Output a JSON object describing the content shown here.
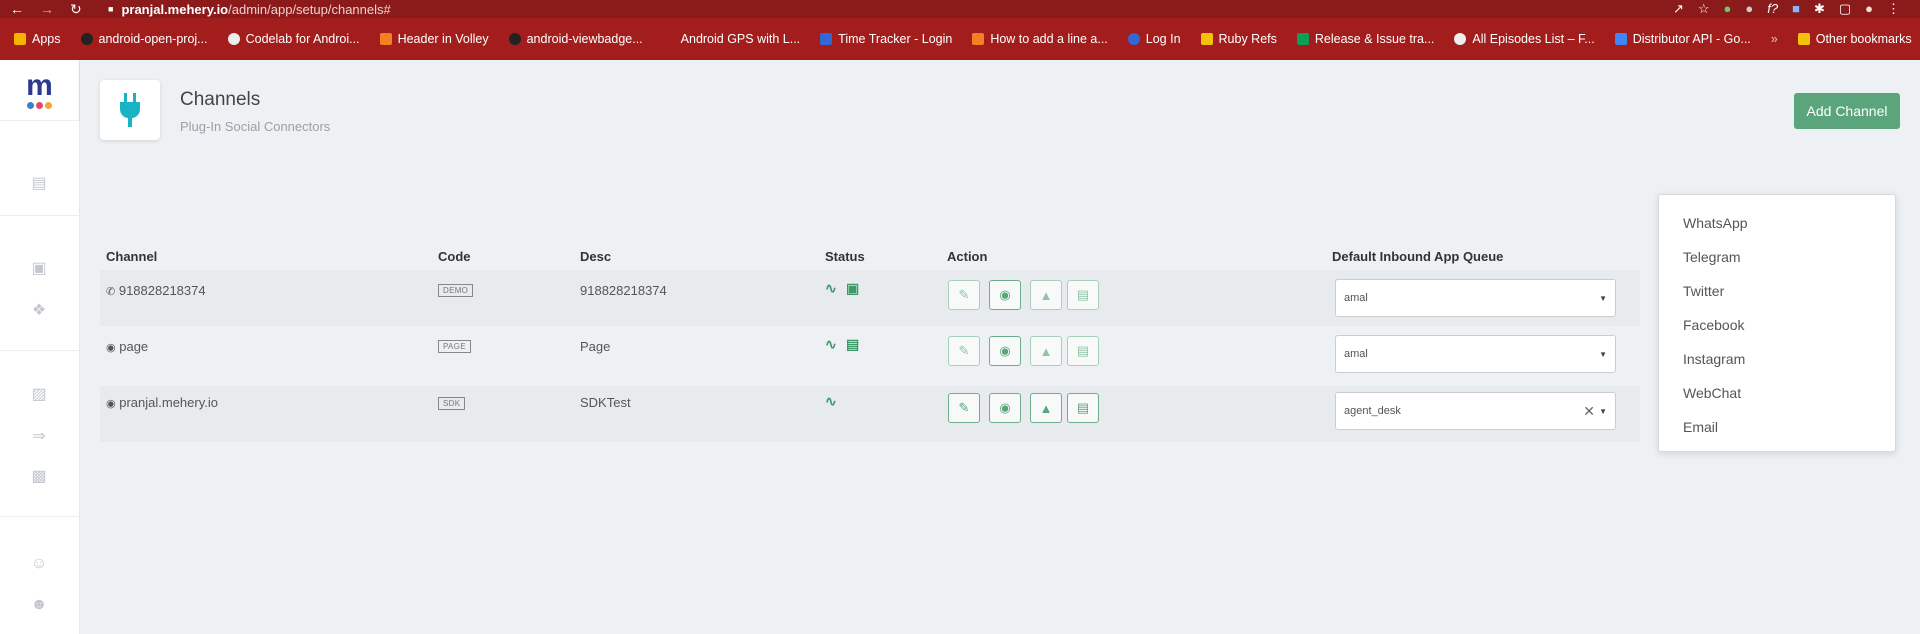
{
  "browser": {
    "url_host": "pranjal.mehery.io",
    "url_path": "/admin/app/setup/channels#"
  },
  "bookmarks": [
    {
      "label": "Apps",
      "color": "#f4b400"
    },
    {
      "label": "android-open-proj...",
      "color": "#222222"
    },
    {
      "label": "Codelab for Androi...",
      "color": "#eeeeee"
    },
    {
      "label": "Header in Volley",
      "color": "#f48024"
    },
    {
      "label": "android-viewbadge...",
      "color": "#222222"
    },
    {
      "label": "Android GPS with L...",
      "color": "#a31d1d"
    },
    {
      "label": "Time Tracker - Login",
      "color": "#3367d6"
    },
    {
      "label": "How to add a line a...",
      "color": "#f48024"
    },
    {
      "label": "Log In",
      "color": "#3367d6"
    },
    {
      "label": "Ruby Refs",
      "color": "#f4c20d"
    },
    {
      "label": "Release & Issue tra...",
      "color": "#0f9d58"
    },
    {
      "label": "All Episodes List – F...",
      "color": "#eeeeee"
    },
    {
      "label": "Distributor API - Go...",
      "color": "#4285f4"
    }
  ],
  "other_bookmarks": "Other bookmarks",
  "logo": {
    "letter": "m"
  },
  "page": {
    "title": "Channels",
    "subtitle": "Plug-In Social Connectors",
    "add_button": "Add Channel"
  },
  "table": {
    "headers": {
      "channel": "Channel",
      "code": "Code",
      "desc": "Desc",
      "status": "Status",
      "action": "Action",
      "queue": "Default Inbound App Queue"
    },
    "rows": [
      {
        "channel": "918828218374",
        "code": "DEMO",
        "desc": "918828218374",
        "queue": "amal"
      },
      {
        "channel": "page",
        "code": "PAGE",
        "desc": "Page",
        "queue": "amal"
      },
      {
        "channel": "pranjal.mehery.io",
        "code": "SDK",
        "desc": "SDKTest",
        "queue": "agent_desk"
      }
    ]
  },
  "dropdown": {
    "items": [
      "WhatsApp",
      "Telegram",
      "Twitter",
      "Facebook",
      "Instagram",
      "WebChat",
      "Email"
    ]
  },
  "colors": {
    "accent": "#5aa57c",
    "browser_bar": "#a31d1d",
    "plug_icon": "#19b3c6"
  }
}
